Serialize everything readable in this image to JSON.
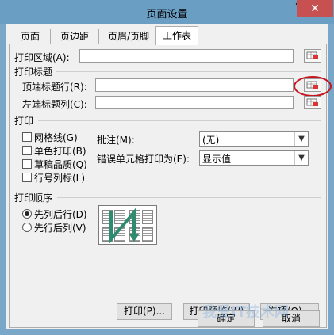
{
  "window": {
    "title": "页面设置",
    "help": "?",
    "close": "✕"
  },
  "tabs": [
    {
      "label": "页面",
      "active": false
    },
    {
      "label": "页边距",
      "active": false
    },
    {
      "label": "页眉/页脚",
      "active": false
    },
    {
      "label": "工作表",
      "active": true
    }
  ],
  "print_area": {
    "label": "打印区域(A):",
    "value": ""
  },
  "print_titles": {
    "heading": "打印标题",
    "rows_label": "顶端标题行(R):",
    "rows_value": "",
    "cols_label": "左端标题列(C):",
    "cols_value": ""
  },
  "print": {
    "heading": "打印",
    "checkboxes": [
      {
        "label": "网格线(G)",
        "checked": false
      },
      {
        "label": "单色打印(B)",
        "checked": false
      },
      {
        "label": "草稿品质(Q)",
        "checked": false
      },
      {
        "label": "行号列标(L)",
        "checked": false
      }
    ],
    "comments_label": "批注(M):",
    "comments_value": "(无)",
    "errors_label": "错误单元格打印为(E):",
    "errors_value": "显示值"
  },
  "page_order": {
    "heading": "打印顺序",
    "options": [
      {
        "label": "先列后行(D)",
        "selected": true
      },
      {
        "label": "先行后列(V)",
        "selected": false
      }
    ]
  },
  "buttons": {
    "print": "打印(P)...",
    "preview": "打印预览(W)",
    "options": "选项(O)...",
    "ok": "确定",
    "cancel": "取消"
  },
  "watermark": "我爱IT技术网",
  "colors": {
    "title_bar": "#6a9ec3",
    "close": "#c75050",
    "highlight": "#c4161c",
    "order_arrow": "#2e8b6f"
  },
  "icons": [
    "help-icon",
    "close-icon",
    "range-select-icon",
    "chevron-down-icon",
    "page-order-preview-icon"
  ]
}
